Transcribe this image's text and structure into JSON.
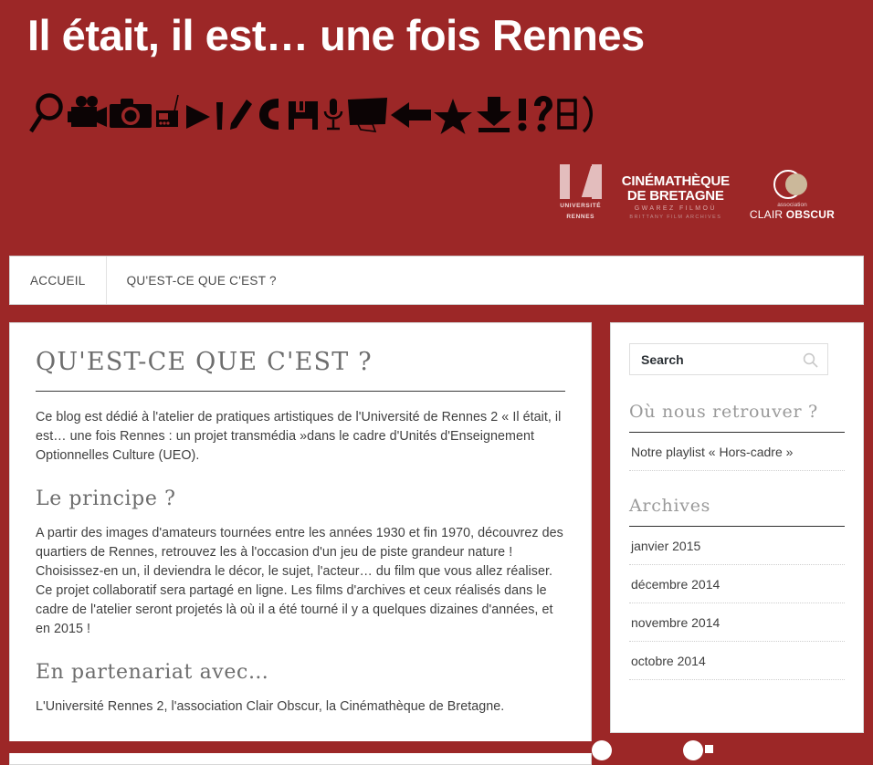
{
  "colors": {
    "brand_red": "#9c2727",
    "panel_white": "#ffffff",
    "heading_grey": "#6e6e6e",
    "body_text": "#3f3f3f",
    "logo_pale": "#e3bdbd",
    "clair_tan": "#cbb89a"
  },
  "header": {
    "site_title": "Il était, il est… une fois Rennes",
    "icon_row": [
      {
        "name": "magnifier-icon",
        "glyph": "⌕"
      },
      {
        "name": "movie-camera-icon",
        "glyph": "🎥"
      },
      {
        "name": "photo-camera-icon",
        "glyph": "📷"
      },
      {
        "name": "radio-icon",
        "glyph": "📻"
      },
      {
        "name": "play-arrow-icon",
        "glyph": "▶"
      },
      {
        "name": "pen-icon",
        "glyph": "✐"
      },
      {
        "name": "pencil-icon",
        "glyph": "✎"
      },
      {
        "name": "telephone-icon",
        "glyph": "✆"
      },
      {
        "name": "floppy-disk-icon",
        "glyph": "💾"
      },
      {
        "name": "microphone-icon",
        "glyph": "🎤"
      },
      {
        "name": "monitor-icon",
        "glyph": "📺"
      },
      {
        "name": "left-arrow-icon",
        "glyph": "←"
      },
      {
        "name": "star-icon",
        "glyph": "★"
      },
      {
        "name": "download-icon",
        "glyph": "⤓"
      },
      {
        "name": "exclamation-icon",
        "glyph": "!"
      },
      {
        "name": "question-icon",
        "glyph": "?"
      },
      {
        "name": "film-strip-icon",
        "glyph": "⌸"
      },
      {
        "name": "closing-paren-icon",
        "glyph": ")"
      }
    ],
    "logos": {
      "rennes": {
        "line1": "UNIVERSITÉ",
        "line2": "RENNES"
      },
      "cinematheque": {
        "line1": "CINÉMATHÈQUE",
        "line2": "DE BRETAGNE",
        "line3": "GWAREZ FILMOÙ",
        "line4": "BRITTANY FILM ARCHIVES"
      },
      "clair_obscur": {
        "line1": "association",
        "line2_light": "CLAIR ",
        "line2_bold": "OBSCUR"
      }
    }
  },
  "nav": {
    "items": [
      {
        "label": "ACCUEIL",
        "name": "nav-item-accueil"
      },
      {
        "label": "QU'EST-CE QUE C'EST ?",
        "name": "nav-item-quest-ce-que-cest"
      }
    ]
  },
  "main": {
    "entry_title": "QU'EST-CE QUE C'EST ?",
    "intro_paragraph": "Ce blog est dédié à l'atelier de pratiques artistiques de l'Université de Rennes 2 « Il était, il est… une fois Rennes : un projet transmédia »dans le cadre d'Unités d'Enseignement Optionnelles Culture (UEO).",
    "sections": [
      {
        "heading": "Le principe ?",
        "paragraph": "A partir des images d'amateurs tournées entre les années 1930 et fin 1970, découvrez des quartiers de Rennes, retrouvez les à l'occasion d'un jeu de piste grandeur nature ! Choisissez-en un, il deviendra le décor, le sujet, l'acteur… du film que vous allez réaliser. Ce projet collaboratif sera partagé en ligne. Les films d'archives et ceux réalisés dans le cadre de l'atelier seront projetés là où il a été tourné il y a quelques dizaines d'années, et en 2015 !"
      },
      {
        "heading": "En partenariat avec…",
        "paragraph": "L'Université Rennes 2, l'association Clair Obscur, la Cinémathèque de Bretagne."
      }
    ]
  },
  "sidebar": {
    "search": {
      "value": "Search",
      "placeholder": "Search",
      "icon": "search-icon"
    },
    "widgets": [
      {
        "title": "Où nous retrouver ?",
        "name": "widget-ou-nous-retrouver",
        "items": [
          {
            "label": "Notre playlist « Hors-cadre »"
          }
        ]
      },
      {
        "title": "Archives",
        "name": "widget-archives",
        "items": [
          {
            "label": "janvier 2015"
          },
          {
            "label": "décembre 2014"
          },
          {
            "label": "novembre 2014"
          },
          {
            "label": "octobre 2014"
          }
        ]
      }
    ]
  }
}
